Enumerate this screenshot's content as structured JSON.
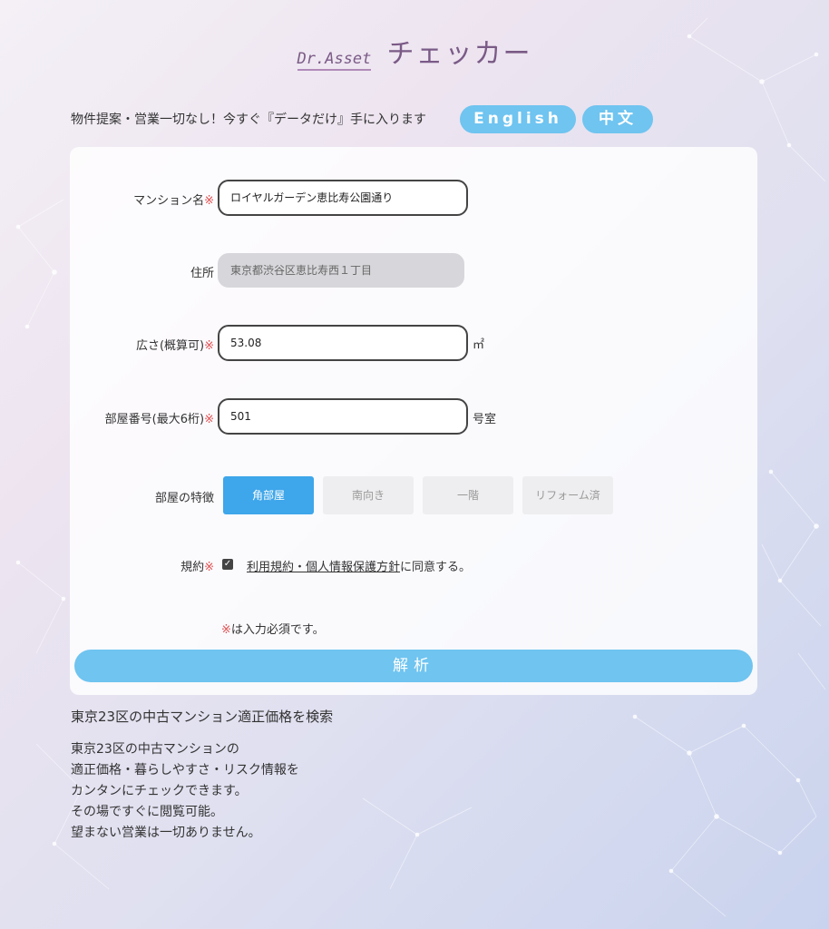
{
  "header": {
    "brand": "Dr.Asset",
    "title": "チェッカー"
  },
  "tagline": "物件提案・営業一切なし！今すぐ『データだけ』手に入ります",
  "languages": [
    "English",
    "中文"
  ],
  "form": {
    "mansion_name": {
      "label": "マンション名",
      "required_mark": "※",
      "value": "ロイヤルガーデン恵比寿公園通り"
    },
    "address": {
      "label": "住所",
      "value": "東京都渋谷区恵比寿西１丁目"
    },
    "area": {
      "label": "広さ(概算可)",
      "required_mark": "※",
      "value": "53.08",
      "unit": "㎡"
    },
    "room_number": {
      "label": "部屋番号(最大6桁)",
      "required_mark": "※",
      "value": "501",
      "unit": "号室"
    },
    "features": {
      "label": "部屋の特徴",
      "options": [
        {
          "label": "角部屋",
          "selected": true
        },
        {
          "label": "南向き",
          "selected": false
        },
        {
          "label": "一階",
          "selected": false
        },
        {
          "label": "リフォーム済",
          "selected": false
        }
      ]
    },
    "terms": {
      "label": "規約",
      "required_mark": "※",
      "checked": true,
      "link_text": "利用規約・個人情報保護方針",
      "suffix": "に同意する。"
    },
    "required_note_mark": "※",
    "required_note": "は入力必須です。",
    "submit_label": "解析"
  },
  "footer": {
    "heading": "東京23区の中古マンション適正価格を検索",
    "lines": [
      "東京23区の中古マンションの",
      "適正価格・暮らしやすさ・リスク情報を",
      "カンタンにチェックできます。",
      "その場ですぐに閲覧可能。",
      "望まない営業は一切ありません。"
    ]
  },
  "colors": {
    "accent": "#6fc4f0",
    "selected_chip": "#3ea6ea",
    "required": "#e05050",
    "logo": "#7a5a86"
  }
}
